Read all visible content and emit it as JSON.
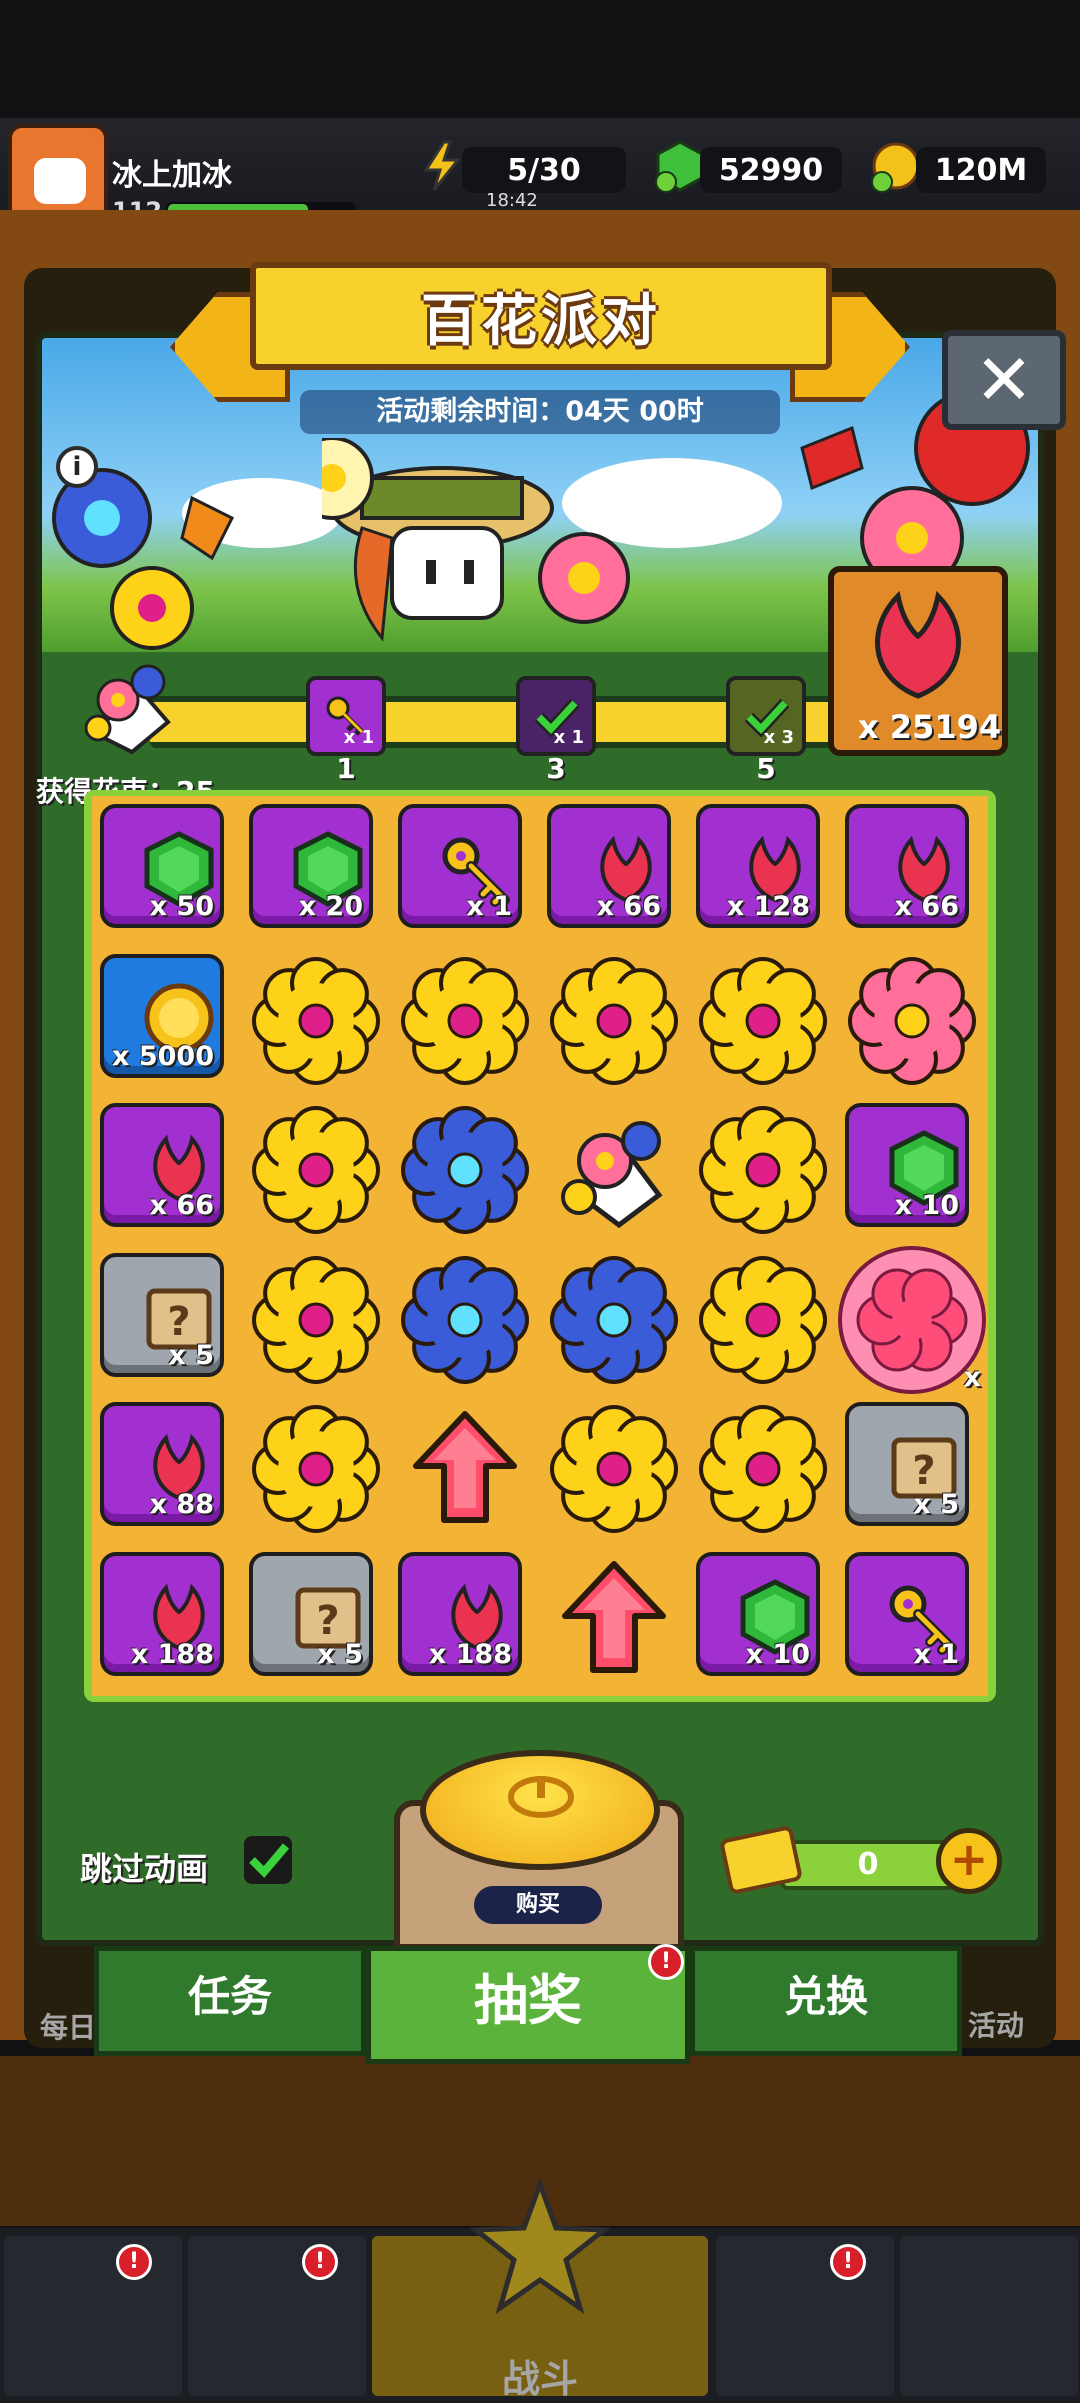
{
  "player": {
    "name": "冰上加冰",
    "level": "112"
  },
  "resources": {
    "energy": "5/30",
    "energy_timer": "18:42",
    "gems": "52990",
    "coins": "120M"
  },
  "event": {
    "title": "百花派对",
    "timer": "活动剩余时间：04天 00时",
    "bouquet_total": "x 25194",
    "gained_label": "获得花束：25",
    "milestones": [
      {
        "count": "x 1",
        "threshold": "1",
        "state": "key"
      },
      {
        "count": "x 1",
        "threshold": "3",
        "state": "claimed"
      },
      {
        "count": "x 3",
        "threshold": "5",
        "state": "claimed"
      }
    ]
  },
  "grid": [
    [
      {
        "type": "gem",
        "qty": "x 50"
      },
      {
        "type": "gem",
        "qty": "x 20"
      },
      {
        "type": "key",
        "qty": "x 1"
      },
      {
        "type": "petal",
        "qty": "x 66"
      },
      {
        "type": "petal",
        "qty": "x 128"
      },
      {
        "type": "petal",
        "qty": "x 66"
      }
    ],
    [
      {
        "type": "coin",
        "qty": "x 5000"
      },
      {
        "type": "yellow-flower"
      },
      {
        "type": "yellow-flower"
      },
      {
        "type": "yellow-flower"
      },
      {
        "type": "yellow-flower"
      },
      {
        "type": "pink-flower"
      }
    ],
    [
      {
        "type": "petal",
        "qty": "x 66"
      },
      {
        "type": "yellow-flower"
      },
      {
        "type": "blue-flower"
      },
      {
        "type": "bouquet"
      },
      {
        "type": "yellow-flower"
      },
      {
        "type": "gem",
        "qty": "x 10"
      }
    ],
    [
      {
        "type": "scroll",
        "qty": "x 5"
      },
      {
        "type": "yellow-flower"
      },
      {
        "type": "blue-flower"
      },
      {
        "type": "blue-flower"
      },
      {
        "type": "yellow-flower"
      },
      {
        "type": "pink-orb",
        "qty": "x"
      }
    ],
    [
      {
        "type": "petal",
        "qty": "x 88"
      },
      {
        "type": "yellow-flower"
      },
      {
        "type": "arrow"
      },
      {
        "type": "yellow-flower"
      },
      {
        "type": "yellow-flower"
      },
      {
        "type": "scroll",
        "qty": "x 5"
      }
    ],
    [
      {
        "type": "petal",
        "qty": "x 188"
      },
      {
        "type": "scroll",
        "qty": "x 5"
      },
      {
        "type": "petal",
        "qty": "x 188"
      },
      {
        "type": "arrow"
      },
      {
        "type": "gem",
        "qty": "x 10"
      },
      {
        "type": "key",
        "qty": "x 1"
      }
    ]
  ],
  "controls": {
    "skip_animation": "跳过动画",
    "buy": "购买",
    "tickets": "0",
    "plus": "+"
  },
  "tabs": [
    {
      "label": "任务"
    },
    {
      "label": "抽奖",
      "badge": "!"
    },
    {
      "label": "兑换"
    }
  ],
  "background_labels": {
    "left": "每日",
    "right": "活动",
    "battle": "战斗"
  },
  "colors": {
    "tile_purple": "#a22fd0",
    "tile_blue": "#1f7be0",
    "tile_gray": "#9fa6ae",
    "accent_yellow": "#f7d12c",
    "grid_bg": "#f3b436"
  }
}
